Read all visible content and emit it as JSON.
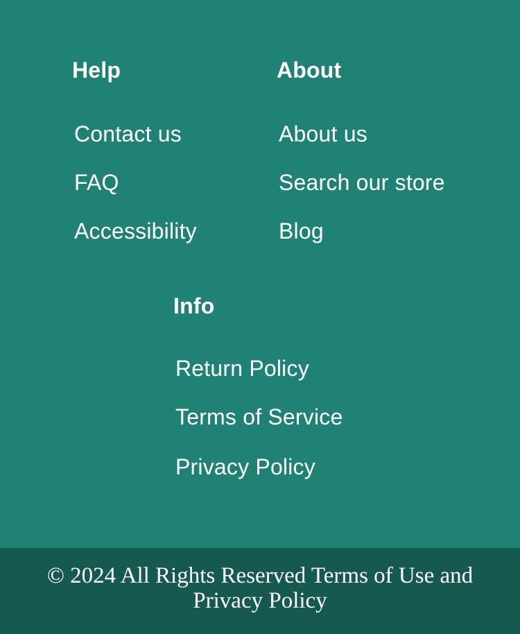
{
  "footer": {
    "columns": [
      {
        "heading": "Help",
        "links": [
          "Contact us",
          "FAQ",
          "Accessibility"
        ]
      },
      {
        "heading": "About",
        "links": [
          "About us",
          "Search our store",
          "Blog"
        ]
      },
      {
        "heading": "Info",
        "links": [
          "Return Policy",
          "Terms of Service",
          "Privacy Policy"
        ]
      }
    ],
    "copyright": {
      "text": "© 2024 All Rights Reserved",
      "terms_link": "Terms of Use",
      "conjunction": "and",
      "privacy_link": "Privacy Policy"
    }
  },
  "colors": {
    "footer_background": "#1f8275",
    "copyright_background": "#165951",
    "text": "#ffffff"
  }
}
